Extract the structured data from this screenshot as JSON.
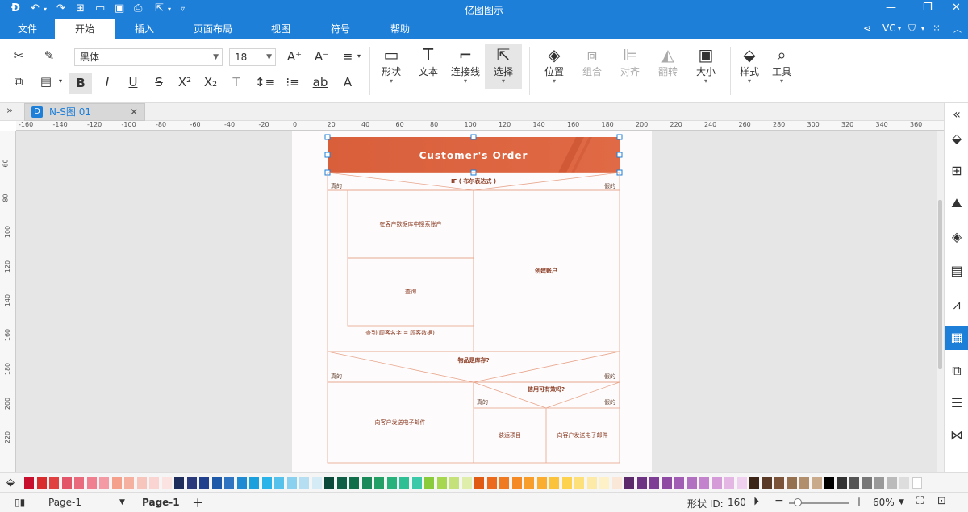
{
  "app": {
    "title": "亿图图示",
    "user": "VC"
  },
  "menu_tabs": [
    "文件",
    "开始",
    "插入",
    "页面布局",
    "视图",
    "符号",
    "帮助"
  ],
  "ribbon": {
    "font_name": "黑体",
    "font_size": "18",
    "big_buttons": [
      "形状",
      "文本",
      "连接线",
      "选择",
      "位置",
      "组合",
      "对齐",
      "翻转",
      "大小",
      "样式",
      "工具"
    ]
  },
  "document_tab": "N-S图 01",
  "rulers": {
    "h_ticks": [
      "-160",
      "-140",
      "-120",
      "-100",
      "-80",
      "-60",
      "-40",
      "-20",
      "0",
      "20",
      "40",
      "60",
      "80",
      "100",
      "120",
      "140",
      "160",
      "180",
      "200",
      "220",
      "240",
      "260",
      "280",
      "300",
      "320",
      "340",
      "360"
    ],
    "v_ticks": [
      "60",
      "80",
      "100",
      "120",
      "140",
      "160",
      "180",
      "200",
      "220"
    ]
  },
  "diagram": {
    "title": "Customer's Order",
    "if_condition": "IF ( 布尔表达式 )",
    "true_label": "真的",
    "false_label": "假的",
    "search_account": "在客户数据库中搜索账户",
    "lookup": "查询",
    "create_account": "创建账户",
    "found": "查到(顾客名字 = 顾客数据)",
    "in_stock_q": "物品是库存?",
    "credit_q": "信用可有效吗?",
    "send_email": "向客户发送电子邮件",
    "ship_item": "装运项目"
  },
  "palette_colors": [
    "#c8102e",
    "#d92d2d",
    "#e0403f",
    "#e35568",
    "#e96a7c",
    "#f08090",
    "#f49aa5",
    "#f5a08a",
    "#f6b0a0",
    "#f8c5bc",
    "#fad4d0",
    "#fbe3e1",
    "#1f2d5c",
    "#2a3a7a",
    "#203f8c",
    "#1e58a8",
    "#2f74c0",
    "#1f8bd2",
    "#1aa0dc",
    "#29b3e8",
    "#56c2ec",
    "#8ad1ef",
    "#b5def2",
    "#d5ecf7",
    "#0b4a3a",
    "#0e5f46",
    "#106e4a",
    "#1a8a5a",
    "#23a065",
    "#26b27a",
    "#2fbf95",
    "#3cc9aa",
    "#8acb3c",
    "#a7d64f",
    "#c5e27a",
    "#dfeeaa",
    "#e15a13",
    "#eb6a1c",
    "#f07a21",
    "#f58a25",
    "#f89c2a",
    "#fbad30",
    "#fbc33b",
    "#fcd24e",
    "#fde07a",
    "#feeaa8",
    "#fef1c8",
    "#fbe7d8",
    "#5c2a6a",
    "#6e3483",
    "#7f3e95",
    "#8f4ba4",
    "#a15db3",
    "#b270c0",
    "#c483cd",
    "#d59ad8",
    "#e4b6e3",
    "#efd0ee",
    "#3c2416",
    "#5a3a26",
    "#7a5338",
    "#96714f",
    "#b18e6c",
    "#c9ab8c",
    "#000000",
    "#333333",
    "#555555",
    "#777777",
    "#999999",
    "#bbbbbb",
    "#dddddd",
    "#ffffff"
  ],
  "status": {
    "page_selector": "Page-1",
    "page_tab": "Page-1",
    "shape_id_label": "形状 ID:",
    "shape_id": "160",
    "zoom": "60%"
  }
}
